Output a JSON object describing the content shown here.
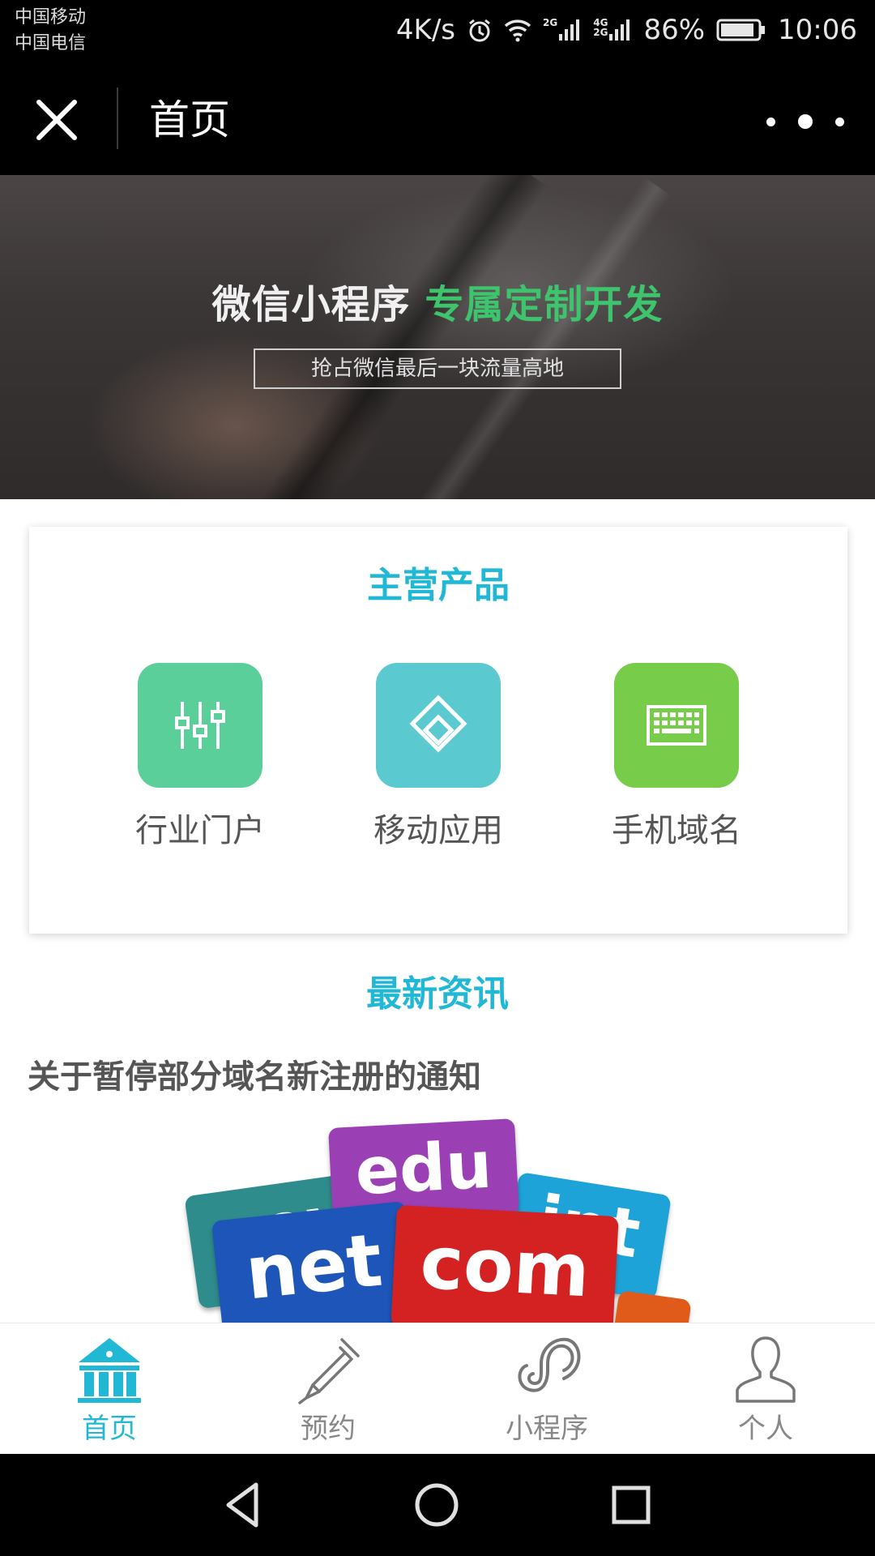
{
  "status_bar": {
    "carrier_1": "中国移动",
    "carrier_2": "中国电信",
    "speed": "4K/s",
    "sim1_type": "2G",
    "sim2_type_top": "4G",
    "sim2_type_bottom": "2G",
    "battery": "86%",
    "time": "10:06"
  },
  "title_bar": {
    "title": "首页"
  },
  "banner": {
    "title_main": "微信小程序",
    "title_highlight": "专属定制开发",
    "subtitle": "抢占微信最后一块流量高地"
  },
  "products": {
    "title": "主营产品",
    "items": [
      {
        "label": "行业门户",
        "icon": "sliders-icon",
        "color": "#5bcf9a"
      },
      {
        "label": "移动应用",
        "icon": "layers-icon",
        "color": "#5bc9d0"
      },
      {
        "label": "手机域名",
        "icon": "keyboard-icon",
        "color": "#77cc4a"
      }
    ]
  },
  "news": {
    "title": "最新资讯",
    "article_title": "关于暂停部分域名新注册的通知",
    "image_words": [
      "gov",
      "edu",
      "int",
      "net",
      "com"
    ]
  },
  "bottom_nav": {
    "items": [
      {
        "label": "首页",
        "icon": "bank-icon",
        "active": true
      },
      {
        "label": "预约",
        "icon": "pen-icon",
        "active": false
      },
      {
        "label": "小程序",
        "icon": "miniprogram-icon",
        "active": false
      },
      {
        "label": "个人",
        "icon": "person-icon",
        "active": false
      }
    ]
  },
  "colors": {
    "accent": "#21b8d6",
    "banner_highlight": "#3ec46d"
  }
}
